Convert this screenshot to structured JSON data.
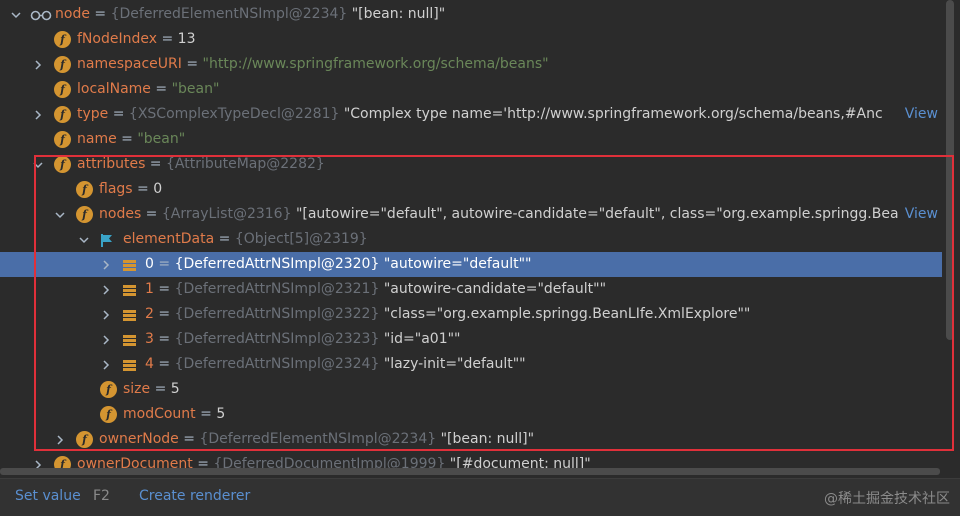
{
  "tree": [
    {
      "kind": "glasses",
      "arrow": "down",
      "name": "node",
      "eq": " = ",
      "type": "{DeferredElementNSImpl@2234}",
      "value": " \"[bean: null]\""
    },
    {
      "kind": "field",
      "arrow": "",
      "name": "fNodeIndex",
      "eq": " = ",
      "type": "",
      "value": "13"
    },
    {
      "kind": "field",
      "arrow": "right",
      "name": "namespaceURI",
      "eq": " = ",
      "type": "",
      "str": "\"http://www.springframework.org/schema/beans\""
    },
    {
      "kind": "field",
      "arrow": "",
      "name": "localName",
      "eq": " = ",
      "type": "",
      "str": "\"bean\""
    },
    {
      "kind": "field",
      "arrow": "right",
      "name": "type",
      "eq": " = ",
      "type": "{XSComplexTypeDecl@2281}",
      "value": " \"Complex type name='http://www.springframework.org/schema/beans,#Anc",
      "view": "View"
    },
    {
      "kind": "field",
      "arrow": "",
      "name": "name",
      "eq": " = ",
      "type": "",
      "str": "\"bean\""
    },
    {
      "kind": "field",
      "arrow": "down",
      "name": "attributes",
      "eq": " = ",
      "type": "{AttributeMap@2282}",
      "value": ""
    },
    {
      "kind": "field",
      "arrow": "",
      "name": "flags",
      "eq": " = ",
      "type": "",
      "value": "0"
    },
    {
      "kind": "field",
      "arrow": "down",
      "name": "nodes",
      "eq": " = ",
      "type": "{ArrayList@2316}",
      "value": " \"[autowire=\"default\", autowire-candidate=\"default\", class=\"org.example.springg.Bea",
      "view": "View"
    },
    {
      "kind": "flag",
      "arrow": "down",
      "name": "elementData",
      "eq": " = ",
      "type": "{Object[5]@2319}",
      "value": ""
    },
    {
      "kind": "element",
      "arrow": "right",
      "name": "0",
      "eq": " = ",
      "type": "{DeferredAttrNSImpl@2320}",
      "value": " \"autowire=\"default\"\"",
      "selected": true
    },
    {
      "kind": "element",
      "arrow": "right",
      "name": "1",
      "eq": " = ",
      "type": "{DeferredAttrNSImpl@2321}",
      "value": " \"autowire-candidate=\"default\"\""
    },
    {
      "kind": "element",
      "arrow": "right",
      "name": "2",
      "eq": " = ",
      "type": "{DeferredAttrNSImpl@2322}",
      "value": " \"class=\"org.example.springg.BeanLIfe.XmlExplore\"\""
    },
    {
      "kind": "element",
      "arrow": "right",
      "name": "3",
      "eq": " = ",
      "type": "{DeferredAttrNSImpl@2323}",
      "value": " \"id=\"a01\"\""
    },
    {
      "kind": "element",
      "arrow": "right",
      "name": "4",
      "eq": " = ",
      "type": "{DeferredAttrNSImpl@2324}",
      "value": " \"lazy-init=\"default\"\""
    },
    {
      "kind": "field",
      "arrow": "",
      "name": "size",
      "eq": " = ",
      "type": "",
      "value": "5"
    },
    {
      "kind": "field",
      "arrow": "",
      "name": "modCount",
      "eq": " = ",
      "type": "",
      "value": "5"
    },
    {
      "kind": "field",
      "arrow": "right",
      "name": "ownerNode",
      "eq": " = ",
      "type": "{DeferredElementNSImpl@2234}",
      "value": " \"[bean: null]\""
    },
    {
      "kind": "field",
      "arrow": "right",
      "name": "ownerDocument",
      "eq": " = ",
      "type": "{DeferredDocumentImpl@1999}",
      "value": " \"[#document: null]\""
    }
  ],
  "bottom": {
    "set_value_label": "Set value",
    "set_value_key": "F2",
    "create_renderer_label": "Create renderer",
    "watermark": "@稀土掘金技术社区"
  },
  "colors": {
    "background": "#2b2b2b",
    "selection": "#4a6ea8",
    "field_name": "#e07b4a",
    "string_value": "#6a8759",
    "type_ref": "#6b7078",
    "link": "#5a8fd0",
    "highlight_box": "#e0303a"
  }
}
